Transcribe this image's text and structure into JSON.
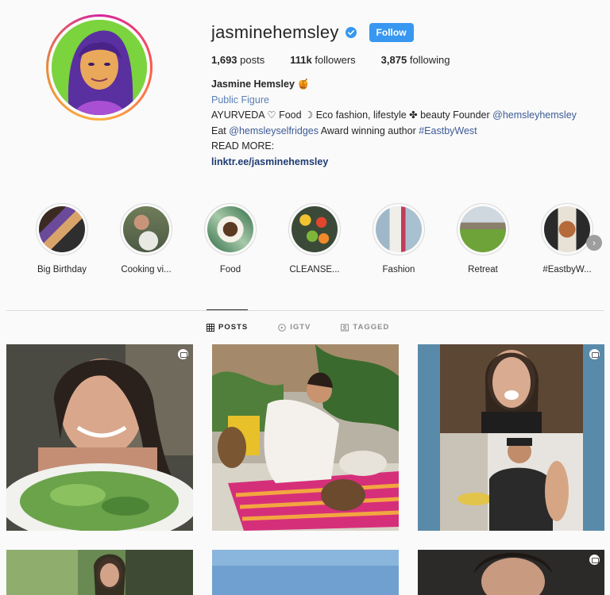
{
  "profile": {
    "username": "jasminehemsley",
    "follow_label": "Follow",
    "stats": {
      "posts_count": "1,693",
      "posts_label": "posts",
      "followers_count": "111k",
      "followers_label": "followers",
      "following_count": "3,875",
      "following_label": "following"
    },
    "bio": {
      "full_name": "Jasmine Hemsley 🍯",
      "category": "Public Figure",
      "line1_text": "AYURVEDA ♡ Food ☽ Eco fashion, lifestyle ✤ beauty Founder ",
      "line1_mention": "@hemsleyhemsley",
      "line2_prefix": "Eat ",
      "line2_mention": "@hemsleyselfridges",
      "line2_mid": " Award winning author ",
      "line2_tag": "#EastbyWest",
      "line3": "READ MORE:",
      "link": "linktr.ee/jasminehemsley"
    }
  },
  "highlights": [
    {
      "label": "Big Birthday"
    },
    {
      "label": "Cooking vi..."
    },
    {
      "label": "Food"
    },
    {
      "label": "CLEANSE..."
    },
    {
      "label": "Fashion"
    },
    {
      "label": "Retreat"
    },
    {
      "label": "#EastbyW..."
    }
  ],
  "highlights_next_icon": "›",
  "tabs": [
    {
      "label": "POSTS",
      "icon": "grid-icon"
    },
    {
      "label": "IGTV",
      "icon": "igtv-icon"
    },
    {
      "label": "TAGGED",
      "icon": "tagged-icon"
    }
  ],
  "colors": {
    "follow_button": "#3897f0",
    "link": "#1f3b73",
    "verified_badge": "#3897f0"
  }
}
